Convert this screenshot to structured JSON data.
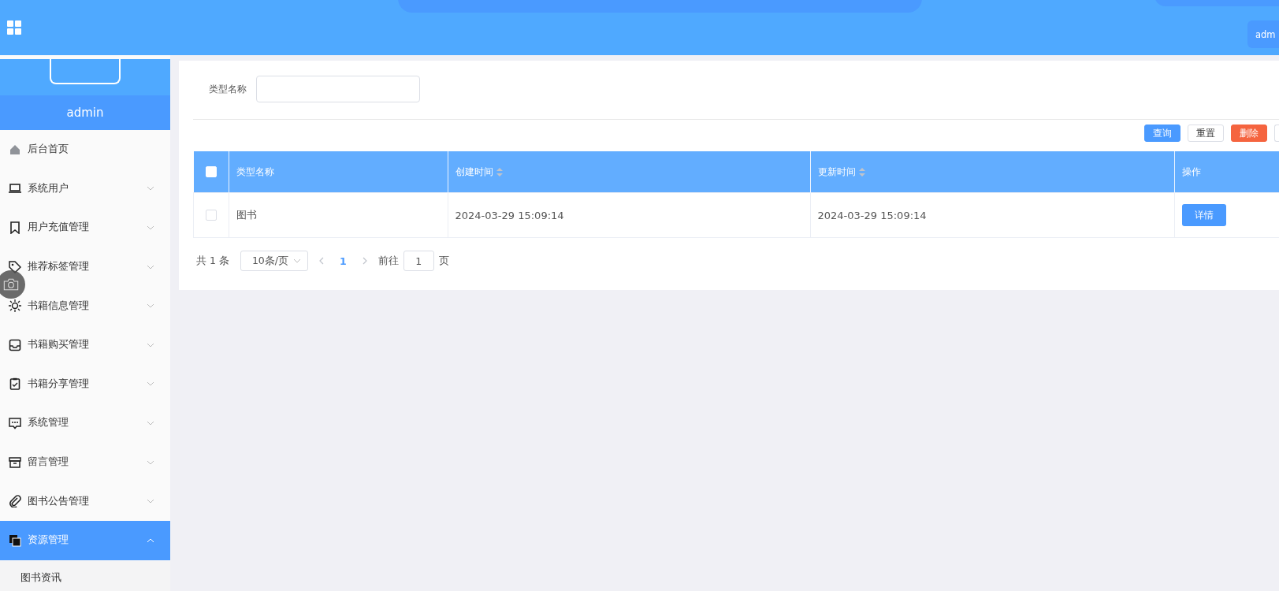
{
  "header": {
    "user_button": "adm"
  },
  "sidebar": {
    "username": "admin",
    "items": [
      {
        "label": "后台首页",
        "selected": false
      },
      {
        "label": "系统用户",
        "selected": false,
        "expanded": false
      },
      {
        "label": "用户充值管理",
        "selected": false,
        "expanded": false
      },
      {
        "label": "推荐标签管理",
        "selected": false,
        "expanded": false
      },
      {
        "label": "书籍信息管理",
        "selected": false,
        "expanded": false
      },
      {
        "label": "书籍购买管理",
        "selected": false,
        "expanded": false
      },
      {
        "label": "书籍分享管理",
        "selected": false,
        "expanded": false
      },
      {
        "label": "系统管理",
        "selected": false,
        "expanded": false
      },
      {
        "label": "留言管理",
        "selected": false,
        "expanded": false
      },
      {
        "label": "图书公告管理",
        "selected": false,
        "expanded": false
      },
      {
        "label": "资源管理",
        "selected": true,
        "expanded": true,
        "children": [
          {
            "label": "图书资讯"
          }
        ]
      }
    ]
  },
  "search": {
    "label": "类型名称"
  },
  "actions": [
    {
      "label": "查询",
      "kind": "primary"
    },
    {
      "label": "重置",
      "kind": "plain"
    },
    {
      "label": "删除",
      "kind": "danger"
    }
  ],
  "table": {
    "all_checked": false,
    "columns": [
      "类型名称",
      "创建时间",
      "更新时间",
      "操作"
    ],
    "sortable": [
      false,
      true,
      true,
      false
    ],
    "rows": [
      {
        "checked": false,
        "cells": [
          "图书",
          "2024-03-29 15:09:14",
          "2024-03-29 15:09:14"
        ],
        "action": "详情"
      }
    ]
  },
  "pagination": {
    "total": "共 1 条",
    "page_size": "10条/页",
    "pages": [
      {
        "label": "1",
        "selected": true
      }
    ],
    "goto_label": "前往",
    "goto_value": "1",
    "page_suffix": "页"
  }
}
